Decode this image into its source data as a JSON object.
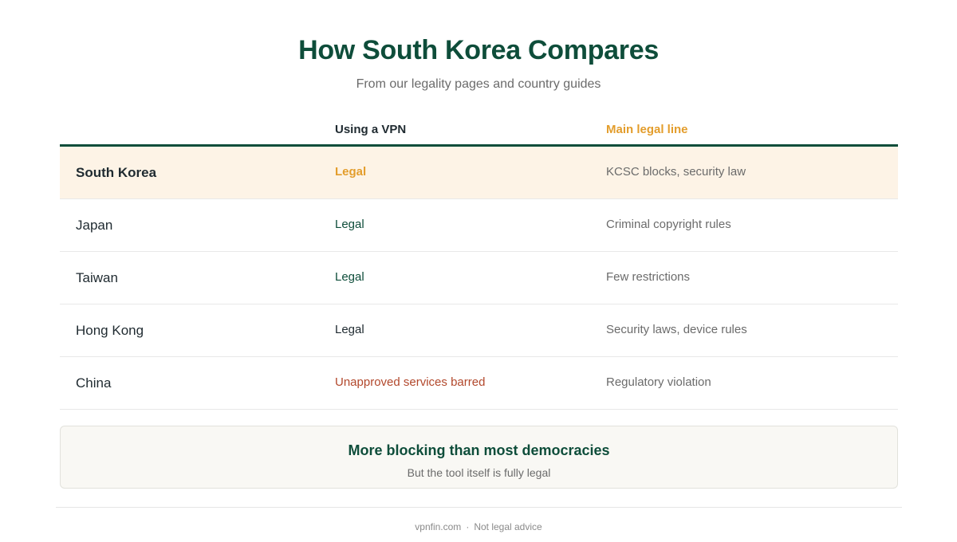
{
  "title": "How South Korea Compares",
  "subtitle": "From our legality pages and country guides",
  "table": {
    "headers": [
      "",
      "Using a VPN",
      "Main legal line"
    ],
    "rows": [
      {
        "country": "South Korea",
        "vpn": "Legal",
        "legal_line": "KCSC blocks, security law"
      },
      {
        "country": "Japan",
        "vpn": "Legal",
        "legal_line": "Criminal copyright rules"
      },
      {
        "country": "Taiwan",
        "vpn": "Legal",
        "legal_line": "Few restrictions"
      },
      {
        "country": "Hong Kong",
        "vpn": "Legal",
        "legal_line": "Security laws, device rules"
      },
      {
        "country": "China",
        "vpn": "Unapproved services barred",
        "legal_line": "Regulatory violation"
      }
    ]
  },
  "callout": {
    "headline": "More blocking than most democracies",
    "subline": "But the tool itself is fully legal"
  },
  "footer": {
    "site": "vpnfin.com",
    "separator": "·",
    "note": "Not legal advice"
  },
  "colors": {
    "accent_green": "#0e4d3a",
    "accent_gold": "#e39d2c",
    "highlight_bg": "#fdf3e6",
    "warning_red": "#b2482c"
  }
}
